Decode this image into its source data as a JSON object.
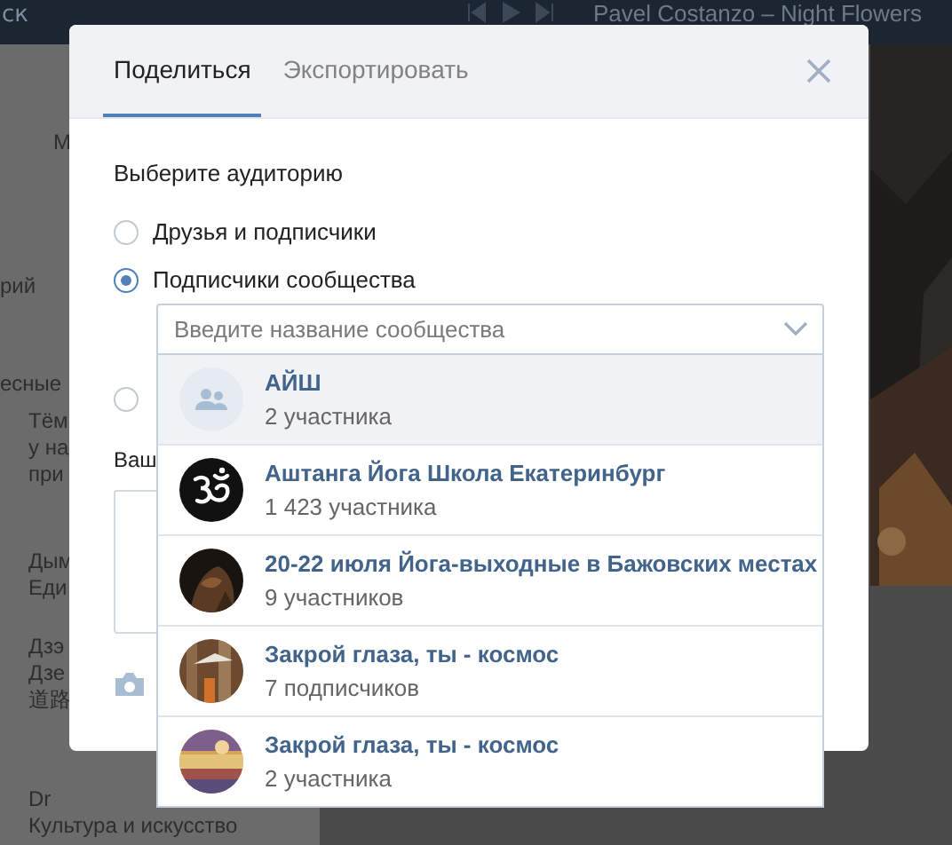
{
  "background": {
    "top_bar": {
      "search_fragment": "ск",
      "track": "Pavel Costanzo – Night Flowers"
    },
    "left_groups": [
      {
        "lines": [
          "М"
        ]
      },
      {
        "lines": [
          "рий"
        ]
      },
      {
        "lines": [
          "есные"
        ]
      },
      {
        "lines": [
          "Тём",
          "у на",
          "при"
        ]
      },
      {
        "lines": [
          "Дым",
          "Еди"
        ]
      },
      {
        "lines": [
          "Дзэ",
          "Дзе",
          "道路"
        ]
      },
      {
        "lines": [
          "Dr",
          "Культура и искусство"
        ]
      }
    ]
  },
  "dialog": {
    "tabs": [
      {
        "label": "Поделиться",
        "selected": true
      },
      {
        "label": "Экспортировать",
        "selected": false
      }
    ],
    "audience_label": "Выберите аудиторию",
    "options": [
      {
        "label": "Друзья и подписчики",
        "selected": false
      },
      {
        "label": "Подписчики сообщества",
        "selected": true
      },
      {
        "selected": false
      }
    ],
    "comment_label": "Ваш",
    "community_field": {
      "placeholder": "Введите название сообщества"
    },
    "communities": [
      {
        "name": "АЙШ",
        "count": "2 участника",
        "kind": "group",
        "selected": true
      },
      {
        "name": "Аштанга Йога Школа Екатеринбург",
        "count": "1 423 участника",
        "kind": "symbol",
        "selected": false
      },
      {
        "name": "20-22 июля Йога-выходные в Бажовских местах",
        "count": "9 участников",
        "selected": false
      },
      {
        "name": "Закрой глаза, ты - космос",
        "count": "7 подписчиков",
        "selected": false
      },
      {
        "name": "Закрой глаза, ты - космос",
        "count": "2 участника",
        "selected": false
      }
    ]
  }
}
